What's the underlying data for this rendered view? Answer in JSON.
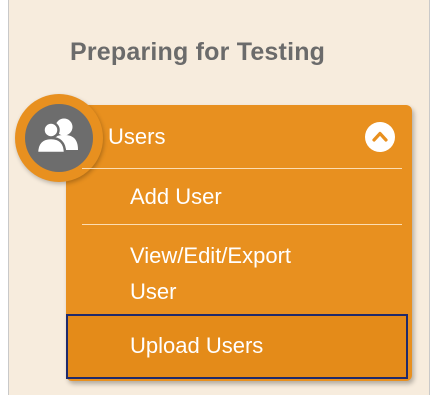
{
  "section": {
    "title": "Preparing for Testing"
  },
  "menu": {
    "header_label": "Users",
    "items": [
      {
        "label": "Add User"
      },
      {
        "label_line1": "View/Edit/Export",
        "label_line2": "User"
      },
      {
        "label": "Upload Users"
      }
    ]
  },
  "icons": {
    "avatar": "users-icon",
    "toggle": "chevron-up-icon"
  },
  "colors": {
    "accent": "#e8901f",
    "panel_bg": "#f7ecdd",
    "avatar_bg": "#6d6d6d",
    "focus_border": "#1f2a6b",
    "title_text": "#6b6b6b"
  }
}
